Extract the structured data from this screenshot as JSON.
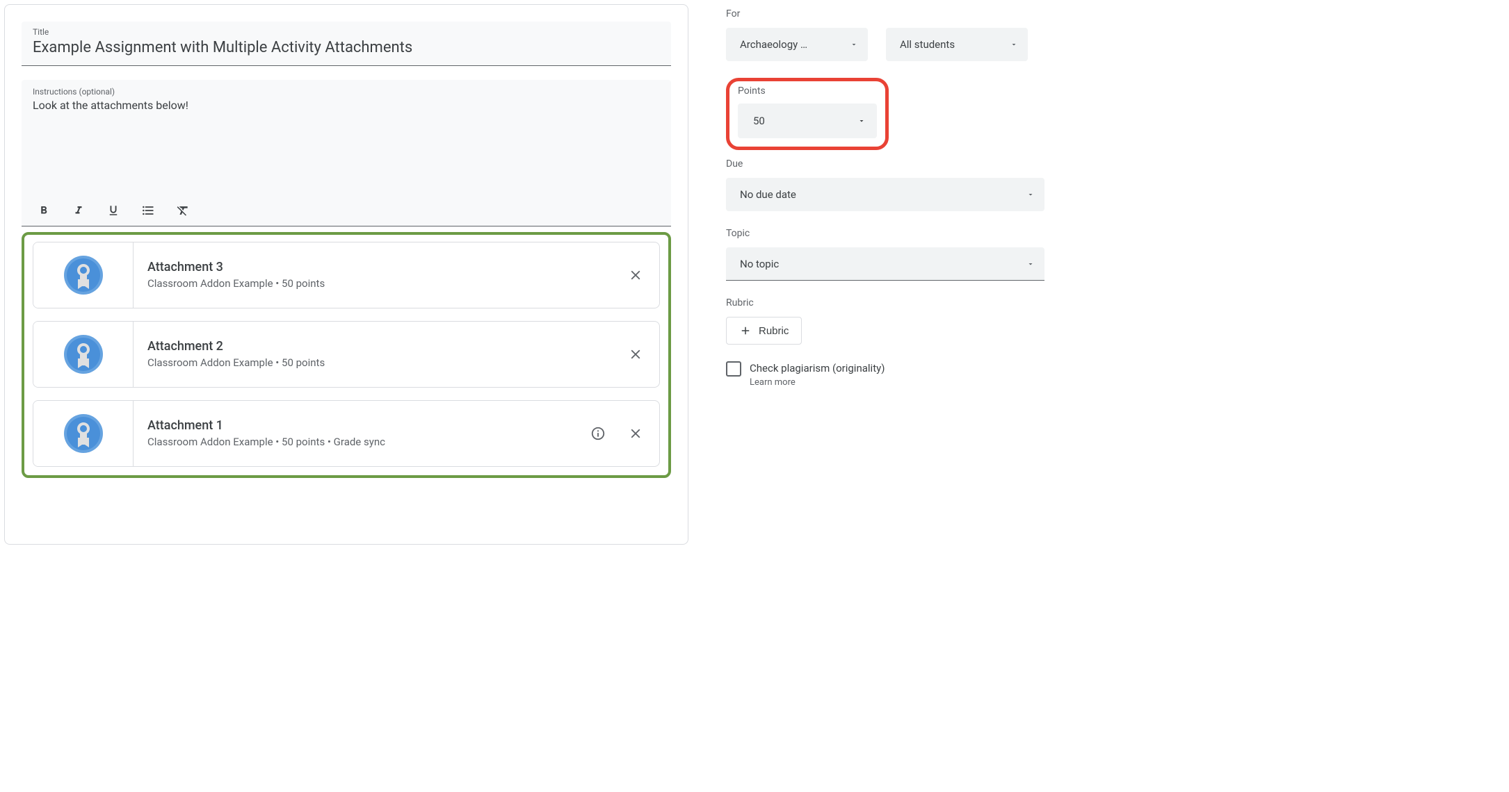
{
  "main": {
    "title_label": "Title",
    "title_value": "Example Assignment with Multiple Activity Attachments",
    "instructions_label": "Instructions (optional)",
    "instructions_value": "Look at the attachments below!"
  },
  "attachments": [
    {
      "title": "Attachment 3",
      "subtitle": "Classroom Addon Example • 50 points",
      "has_info": false
    },
    {
      "title": "Attachment 2",
      "subtitle": "Classroom Addon Example • 50 points",
      "has_info": false
    },
    {
      "title": "Attachment 1",
      "subtitle": "Classroom Addon Example • 50 points • Grade sync",
      "has_info": true
    }
  ],
  "side": {
    "for_label": "For",
    "for_class": "Archaeology …",
    "for_students": "All students",
    "points_label": "Points",
    "points_value": "50",
    "due_label": "Due",
    "due_value": "No due date",
    "topic_label": "Topic",
    "topic_value": "No topic",
    "rubric_label": "Rubric",
    "rubric_button": "Rubric",
    "plagiarism_label": "Check plagiarism (originality)",
    "learn_more": "Learn more"
  }
}
